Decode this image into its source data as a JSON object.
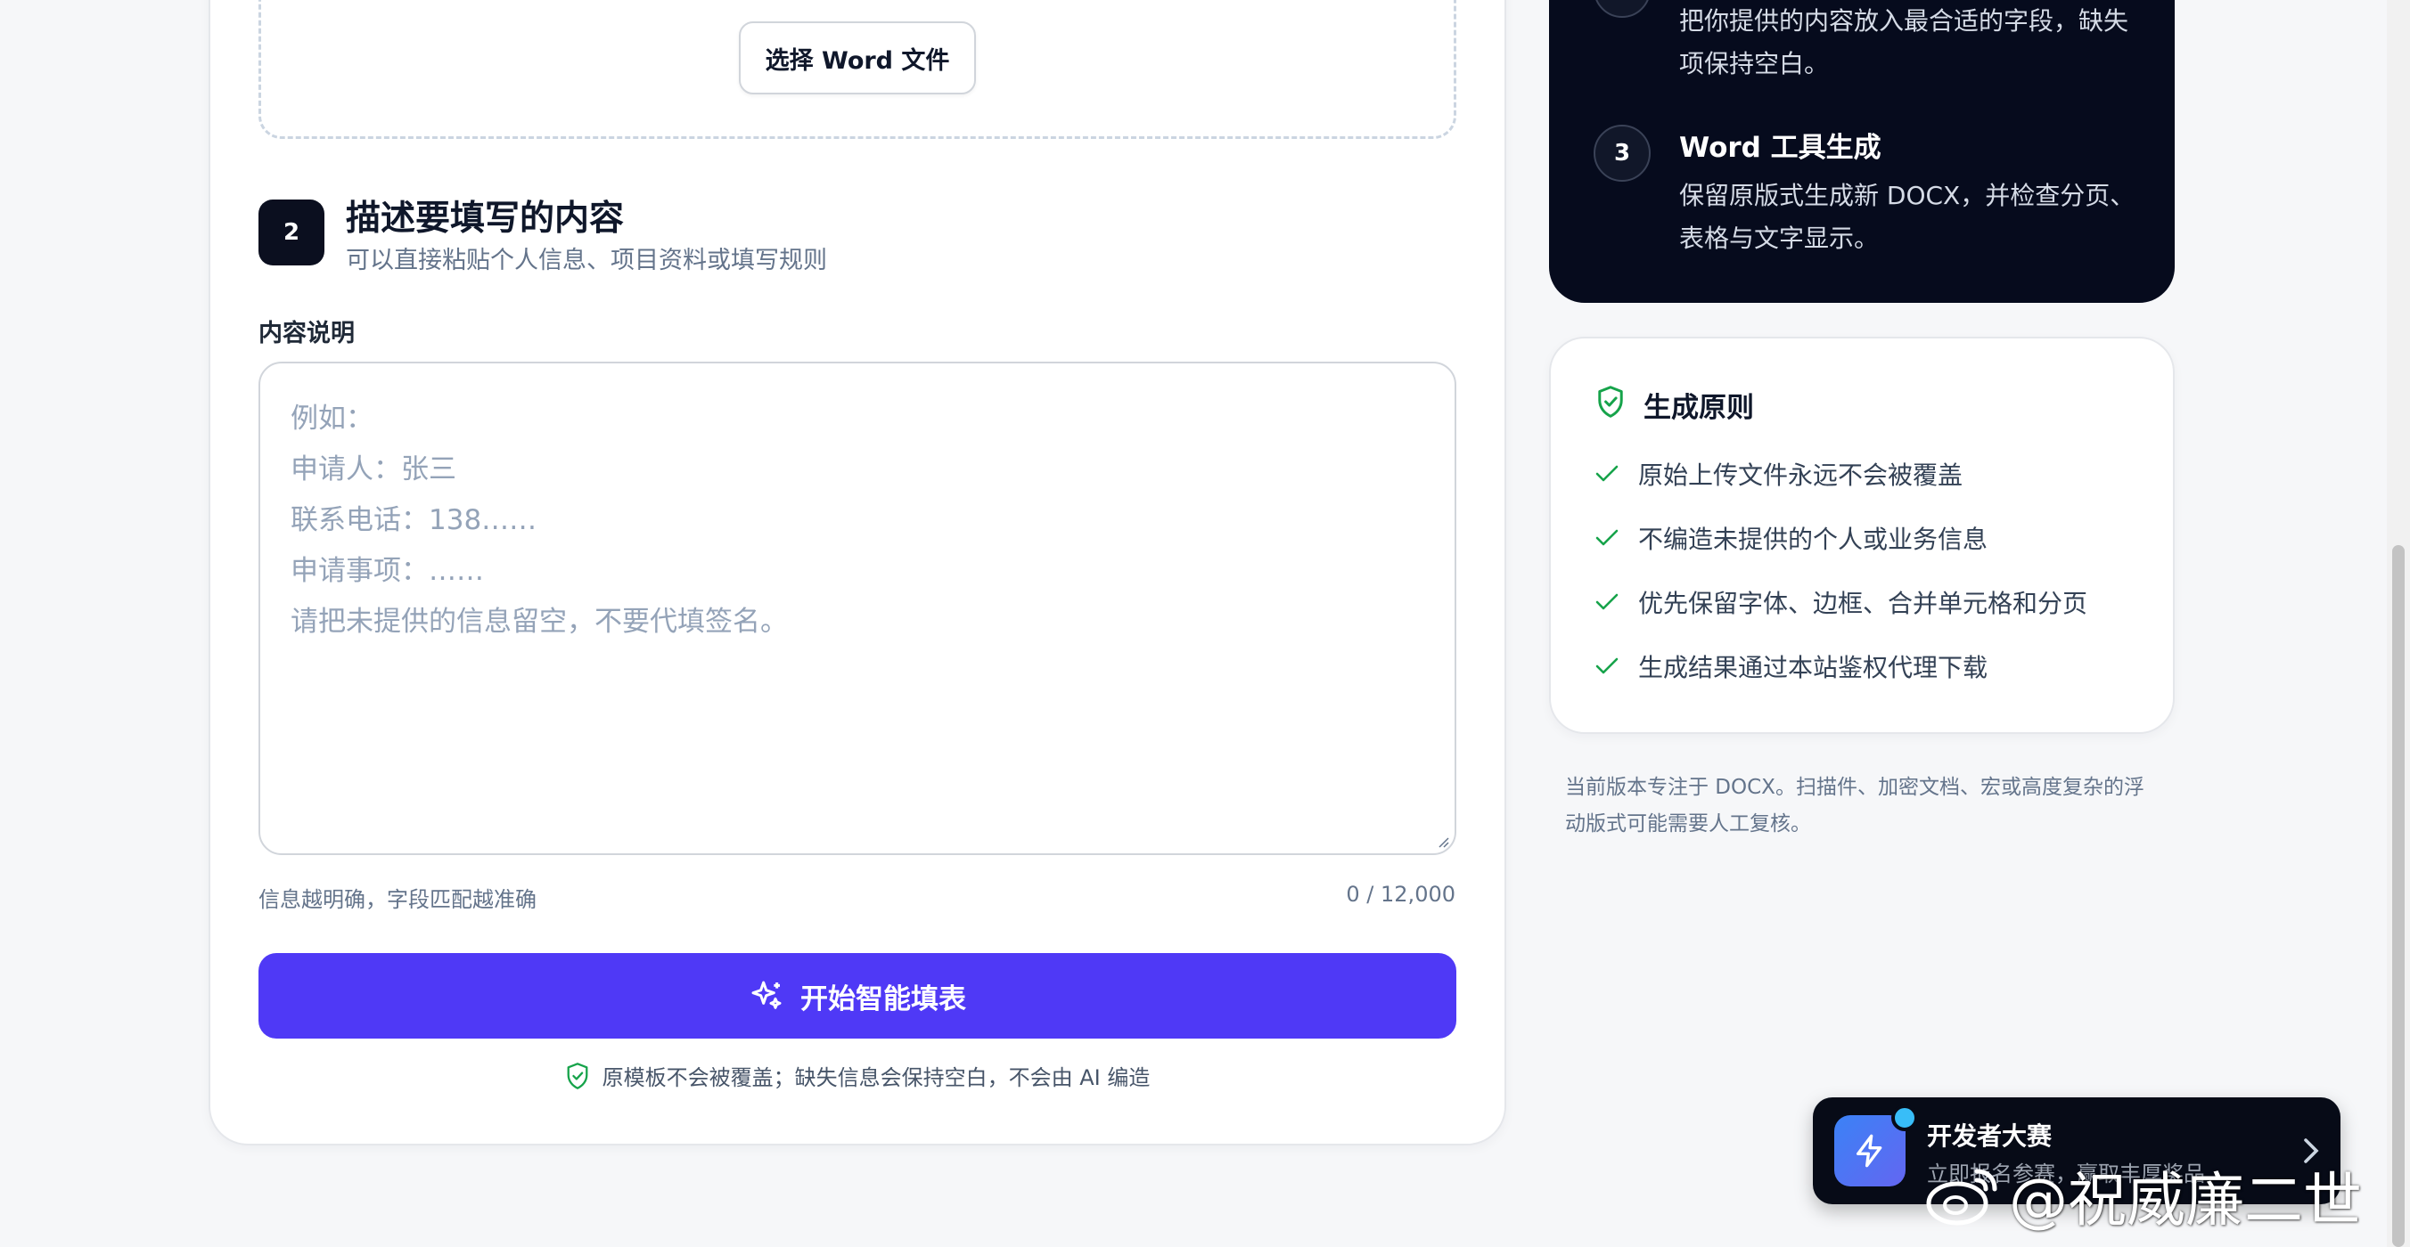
{
  "upload": {
    "select_button": "选择 Word 文件"
  },
  "step2": {
    "number": "2",
    "title": "描述要填写的内容",
    "subtitle": "可以直接粘贴个人信息、项目资料或填写规则",
    "field_label": "内容说明",
    "placeholder_lines": [
      "例如：",
      "申请人：张三",
      "联系电话：138……",
      "申请事项：……",
      "请把未提供的信息留空，不要代填签名。"
    ],
    "hint": "信息越明确，字段匹配越准确",
    "char_count": "0 / 12,000",
    "submit_label": "开始智能填表",
    "note": "原模板不会被覆盖；缺失信息会保持空白，不会由 AI 编造"
  },
  "workflow": {
    "previous_desc": "把你提供的内容放入最合适的字段，缺失项保持空白。",
    "step3_number": "3",
    "step3_title": "Word 工具生成",
    "step3_desc": "保留原版式生成新 DOCX，并检查分页、表格与文字显示。"
  },
  "principles": {
    "title": "生成原则",
    "items": [
      "原始上传文件永远不会被覆盖",
      "不编造未提供的个人或业务信息",
      "优先保留字体、边框、合并单元格和分页",
      "生成结果通过本站鉴权代理下载"
    ]
  },
  "footnote": "当前版本专注于 DOCX。扫描件、加密文档、宏或高度复杂的浮动版式可能需要人工复核。",
  "promo": {
    "title": "开发者大赛",
    "subtitle": "立即报名参赛，赢取丰厚奖品"
  },
  "watermark": "@祝威廉二世",
  "colors": {
    "primary": "#4f39f6",
    "dark_card": "#060b1d",
    "success": "#16a34a"
  }
}
